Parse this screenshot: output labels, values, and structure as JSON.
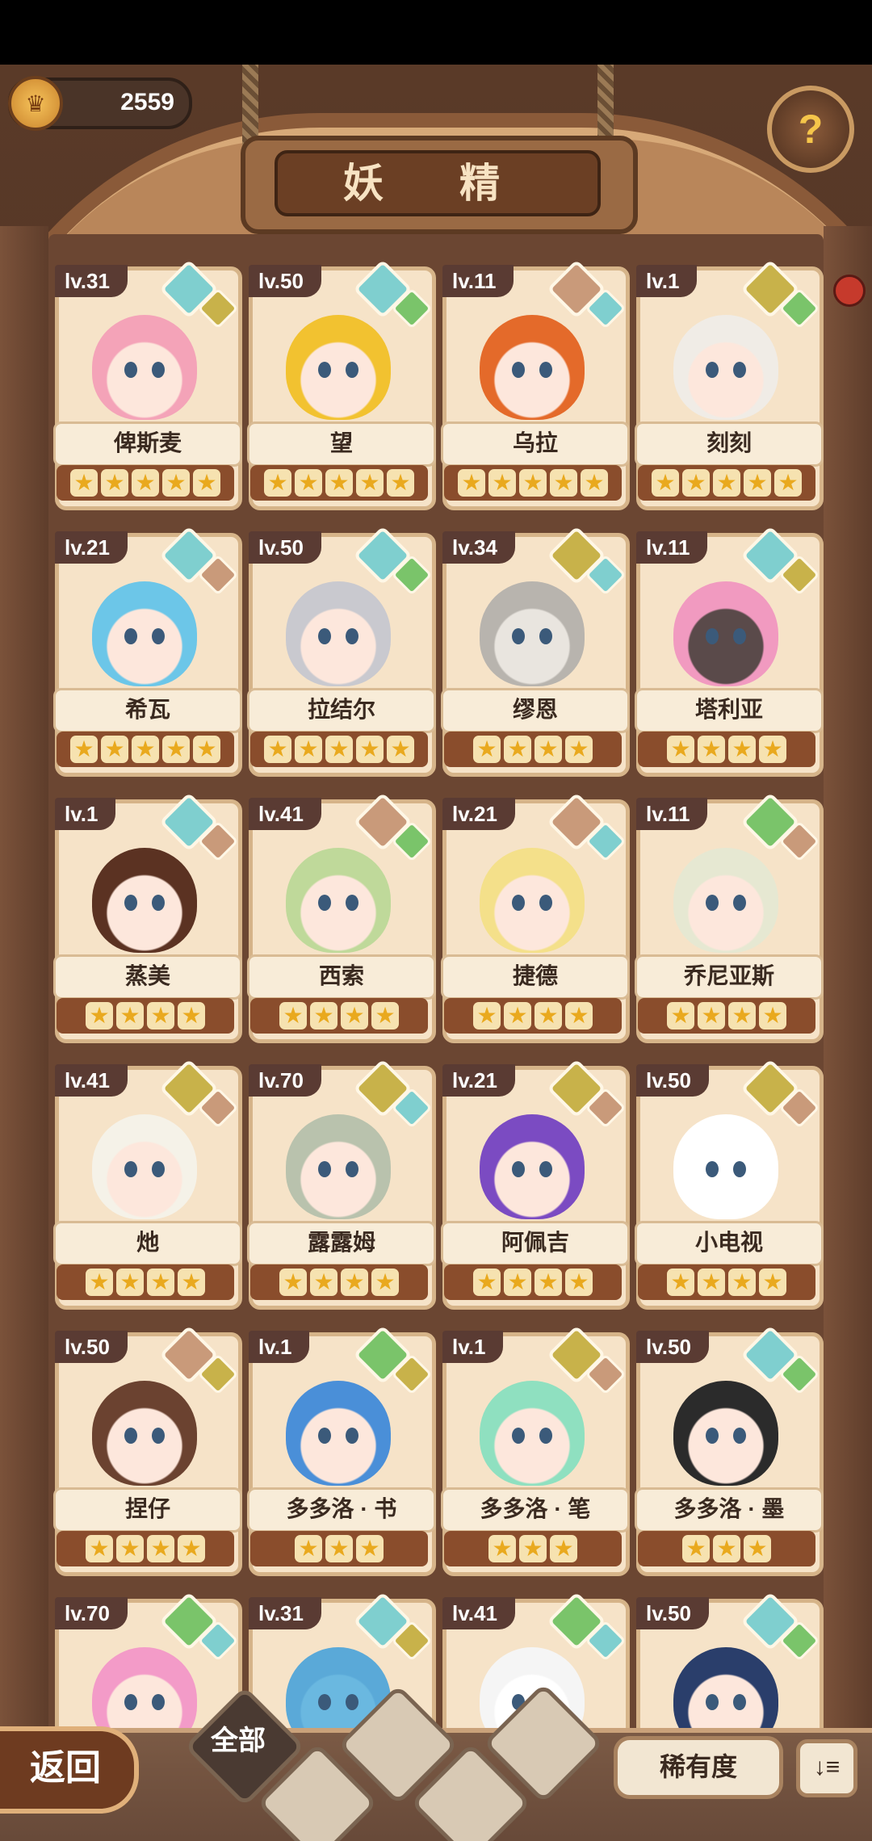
{
  "header": {
    "coins": "2559",
    "title": "妖 精",
    "help_icon": "question-sprout-icon"
  },
  "fairies": [
    {
      "level": "lv.31",
      "name": "俾斯麦",
      "stars": 5,
      "gem": "#7fcfcf",
      "gem2": "#c8b24a",
      "hair": "#f4a3b8",
      "skin": "#fde7dc"
    },
    {
      "level": "lv.50",
      "name": "望",
      "stars": 5,
      "gem": "#7fcfcf",
      "gem2": "#7ac46a",
      "hair": "#f2c230",
      "skin": "#fde7dc"
    },
    {
      "level": "lv.11",
      "name": "乌拉",
      "stars": 5,
      "gem": "#c99a7a",
      "gem2": "#7fcfcf",
      "hair": "#e46a2a",
      "skin": "#fde7dc"
    },
    {
      "level": "lv.1",
      "name": "刻刻",
      "stars": 5,
      "gem": "#c8b24a",
      "gem2": "#7ac46a",
      "hair": "#f0ece6",
      "skin": "#fde7dc"
    },
    {
      "level": "lv.21",
      "name": "希瓦",
      "stars": 5,
      "gem": "#7fcfcf",
      "gem2": "#c99a7a",
      "hair": "#6cc6e8",
      "skin": "#fde7dc"
    },
    {
      "level": "lv.50",
      "name": "拉结尔",
      "stars": 5,
      "gem": "#7fcfcf",
      "gem2": "#7ac46a",
      "hair": "#c9c9cf",
      "skin": "#fde7dc"
    },
    {
      "level": "lv.34",
      "name": "缪恩",
      "stars": 4,
      "gem": "#c8b24a",
      "gem2": "#7fcfcf",
      "hair": "#b8b4ae",
      "skin": "#e9e5df"
    },
    {
      "level": "lv.11",
      "name": "塔利亚",
      "stars": 4,
      "gem": "#7fcfcf",
      "gem2": "#c8b24a",
      "hair": "#f19ac0",
      "skin": "#5a4a4a"
    },
    {
      "level": "lv.1",
      "name": "蒸美",
      "stars": 4,
      "gem": "#7fcfcf",
      "gem2": "#c99a7a",
      "hair": "#5b3222",
      "skin": "#fde7dc"
    },
    {
      "level": "lv.41",
      "name": "西索",
      "stars": 4,
      "gem": "#c99a7a",
      "gem2": "#7ac46a",
      "hair": "#bfd99a",
      "skin": "#fde7dc"
    },
    {
      "level": "lv.21",
      "name": "捷德",
      "stars": 4,
      "gem": "#c99a7a",
      "gem2": "#7fcfcf",
      "hair": "#f4e08a",
      "skin": "#fde7dc"
    },
    {
      "level": "lv.11",
      "name": "乔尼亚斯",
      "stars": 4,
      "gem": "#7ac46a",
      "gem2": "#c99a7a",
      "hair": "#e6e8d2",
      "skin": "#fde7dc"
    },
    {
      "level": "lv.41",
      "name": "灺",
      "stars": 4,
      "gem": "#c8b24a",
      "gem2": "#c99a7a",
      "hair": "#f5f2e8",
      "skin": "#fde7dc"
    },
    {
      "level": "lv.70",
      "name": "露露姆",
      "stars": 4,
      "gem": "#c8b24a",
      "gem2": "#7fcfcf",
      "hair": "#b9c2ad",
      "skin": "#fde7dc"
    },
    {
      "level": "lv.21",
      "name": "阿佩吉",
      "stars": 4,
      "gem": "#c8b24a",
      "gem2": "#c99a7a",
      "hair": "#7b4bc2",
      "skin": "#fde7dc"
    },
    {
      "level": "lv.50",
      "name": "小电视",
      "stars": 4,
      "gem": "#c8b24a",
      "gem2": "#c99a7a",
      "hair": "#ffffff",
      "skin": "#ffffff"
    },
    {
      "level": "lv.50",
      "name": "捏仔",
      "stars": 4,
      "gem": "#c99a7a",
      "gem2": "#c8b24a",
      "hair": "#6b4230",
      "skin": "#fde7dc"
    },
    {
      "level": "lv.1",
      "name": "多多洛 · 书",
      "stars": 3,
      "gem": "#7ac46a",
      "gem2": "#c8b24a",
      "hair": "#4a8fd8",
      "skin": "#fde7dc"
    },
    {
      "level": "lv.1",
      "name": "多多洛 · 笔",
      "stars": 3,
      "gem": "#c8b24a",
      "gem2": "#c99a7a",
      "hair": "#8fe0c0",
      "skin": "#fde7dc"
    },
    {
      "level": "lv.50",
      "name": "多多洛 · 墨",
      "stars": 3,
      "gem": "#7fcfcf",
      "gem2": "#7ac46a",
      "hair": "#2b2b2b",
      "skin": "#fde7dc"
    },
    {
      "level": "lv.70",
      "name": "",
      "stars": 0,
      "gem": "#7ac46a",
      "gem2": "#7fcfcf",
      "hair": "#f39bc8",
      "skin": "#fde7dc"
    },
    {
      "level": "lv.31",
      "name": "",
      "stars": 0,
      "gem": "#7fcfcf",
      "gem2": "#c8b24a",
      "hair": "#5aa9d8",
      "skin": "#6ab8e0"
    },
    {
      "level": "lv.41",
      "name": "",
      "stars": 0,
      "gem": "#7ac46a",
      "gem2": "#7fcfcf",
      "hair": "#f5f5f5",
      "skin": "#ffffff"
    },
    {
      "level": "lv.50",
      "name": "",
      "stars": 0,
      "gem": "#7fcfcf",
      "gem2": "#7ac46a",
      "hair": "#2a3e6b",
      "skin": "#fde7dc"
    }
  ],
  "bottom": {
    "back_label": "返回",
    "filter_all_label": "全部",
    "filters": [
      "all-filter",
      "water-filter",
      "leaf-filter",
      "fire-filter",
      "earth-filter"
    ],
    "sort_label": "稀有度",
    "order_icon": "sort-order-icon"
  }
}
